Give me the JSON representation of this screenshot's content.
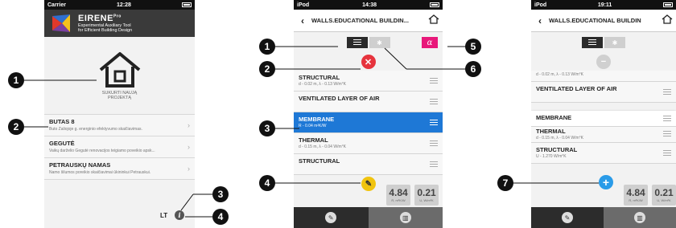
{
  "screen1": {
    "status": {
      "carrier": "Carrier",
      "time": "12:28"
    },
    "app": {
      "name": "EIRENE",
      "pro": "Pro",
      "desc1": "Experimental Auxiliary Tool",
      "desc2": "for Efficient Building Design"
    },
    "new_project": {
      "line1": "SUKURTI NAUJĄ",
      "line2": "PROJEKTĄ"
    },
    "projects": [
      {
        "name": "BUTAS 8",
        "desc": "Buto Žaliojoje g. energinio efektyvumo skaičiavimas."
      },
      {
        "name": "GEGUTĖ",
        "desc": "Vaikų darželio Gegutė renovacijos teigiamo poveikio apsk..."
      },
      {
        "name": "PETRAUSKŲ NAMAS",
        "desc": "Namo šilumos poreikio skaičiavimai ūkininkui Petrauskui."
      }
    ],
    "language": "LT",
    "info_icon": "i"
  },
  "screen2": {
    "status": {
      "carrier": "iPod",
      "time": "14:38"
    },
    "title": "WALLS.EDUCATIONAL BUILDIN...",
    "alpha": "α",
    "layers": [
      {
        "name": "STRUCTURAL",
        "desc": "d - 0.02 m, λ - 0.13 W/m°K"
      },
      {
        "name": "VENTILATED LAYER OF AIR",
        "desc": ""
      },
      {
        "name": "MEMBRANE",
        "desc": "R - 0.04 m²K/W"
      },
      {
        "name": "THERMAL",
        "desc": "d - 0.15 m, λ - 0.04 W/m°K"
      },
      {
        "name": "STRUCTURAL",
        "desc": ""
      }
    ],
    "metrics": [
      {
        "value": "4.84",
        "unit": "R, m²K/W"
      },
      {
        "value": "0.21",
        "unit": "U, W/m²K"
      }
    ]
  },
  "screen3": {
    "status": {
      "carrier": "iPod",
      "time": "19:11"
    },
    "title": "WALLS.EDUCATIONAL BUILDIN",
    "layers": [
      {
        "name": "",
        "desc": "d - 0.02 m, λ - 0.13 W/m°K"
      },
      {
        "name": "VENTILATED LAYER OF AIR",
        "desc": ""
      },
      {
        "name": "MEMBRANE",
        "desc": "R - 0.04 m²K/W"
      },
      {
        "name": "THERMAL",
        "desc": "d - 0.15 m, λ - 0.04 W/m°K"
      },
      {
        "name": "STRUCTURAL",
        "desc": "U - 1.270 W/m°K"
      }
    ],
    "metrics": [
      {
        "value": "4.84",
        "unit": "R, m²K/W"
      },
      {
        "value": "0.21",
        "unit": "U, W/m²K"
      }
    ]
  },
  "callouts": [
    "1",
    "2",
    "3",
    "4",
    "1",
    "2",
    "3",
    "4",
    "5",
    "6",
    "7"
  ],
  "colors": {
    "accent_blue": "#1e78d6",
    "delete_red": "#e6333d",
    "tools_yellow": "#f1c40f",
    "add_blue": "#2a9be8",
    "alpha_pink": "#e8187a"
  }
}
